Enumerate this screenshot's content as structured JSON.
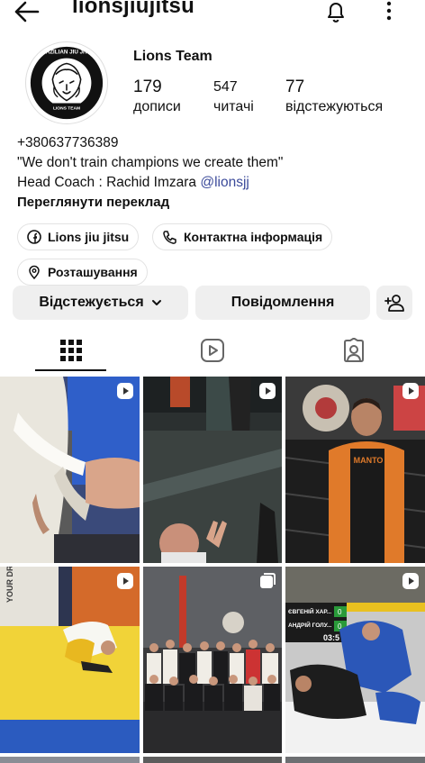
{
  "header": {
    "username": "lionsjiujitsu",
    "back_icon": "arrow-left-icon",
    "bell_icon": "bell-icon",
    "more_icon": "more-vertical-icon"
  },
  "profile": {
    "avatar_icon": "brazilian-jiu-jitsu-lion-logo",
    "avatar_text_top": "BRAZILIAN JIU JITSU",
    "avatar_text_bottom": "LIONS TEAM",
    "display_name": "Lions Team",
    "stats": {
      "posts": {
        "value": "179",
        "label": "дописи"
      },
      "followers": {
        "value": "547",
        "label": "читачі"
      },
      "following": {
        "value": "77",
        "label": "відстежуються"
      }
    },
    "bio": {
      "phone": "+380637736389",
      "quote": "\"We don't train champions we create them\"",
      "coach_prefix": "Head Coach : Rachid Imzara ",
      "mention": "@lionsjj",
      "translate": "Переглянути переклад"
    }
  },
  "chips": {
    "facebook": {
      "label": "Lions jiu jitsu",
      "icon": "facebook-icon"
    },
    "contact": {
      "label": "Контактна інформація",
      "icon": "phone-icon"
    },
    "location": {
      "label": "Розташування",
      "icon": "location-pin-icon"
    }
  },
  "actions": {
    "following_label": "Відстежується",
    "message_label": "Повідомлення",
    "add_person_icon": "add-person-icon"
  },
  "tabs": [
    {
      "name": "posts",
      "icon": "grid-icon",
      "active": true
    },
    {
      "name": "reels",
      "icon": "reels-icon",
      "active": false
    },
    {
      "name": "tagged",
      "icon": "tagged-icon",
      "active": false
    }
  ],
  "grid": [
    {
      "kind": "reel",
      "description_color": "#c9c6bd"
    },
    {
      "kind": "reel",
      "description_color": "#2d3232"
    },
    {
      "kind": "reel",
      "description_color": "#262626"
    },
    {
      "kind": "reel",
      "description_color": "#f1d338"
    },
    {
      "kind": "carousel",
      "description_color": "#3a3a3c"
    },
    {
      "kind": "reel",
      "description_color": "#2b57b8"
    }
  ],
  "scoreboard": {
    "name1": "ЄВГЕНІЙ ХАР...",
    "name2": "АНДРІЙ ГОЛУ...",
    "score1": "0",
    "score2": "0",
    "time": "03:5"
  },
  "banner_text": "YOUR DRE"
}
